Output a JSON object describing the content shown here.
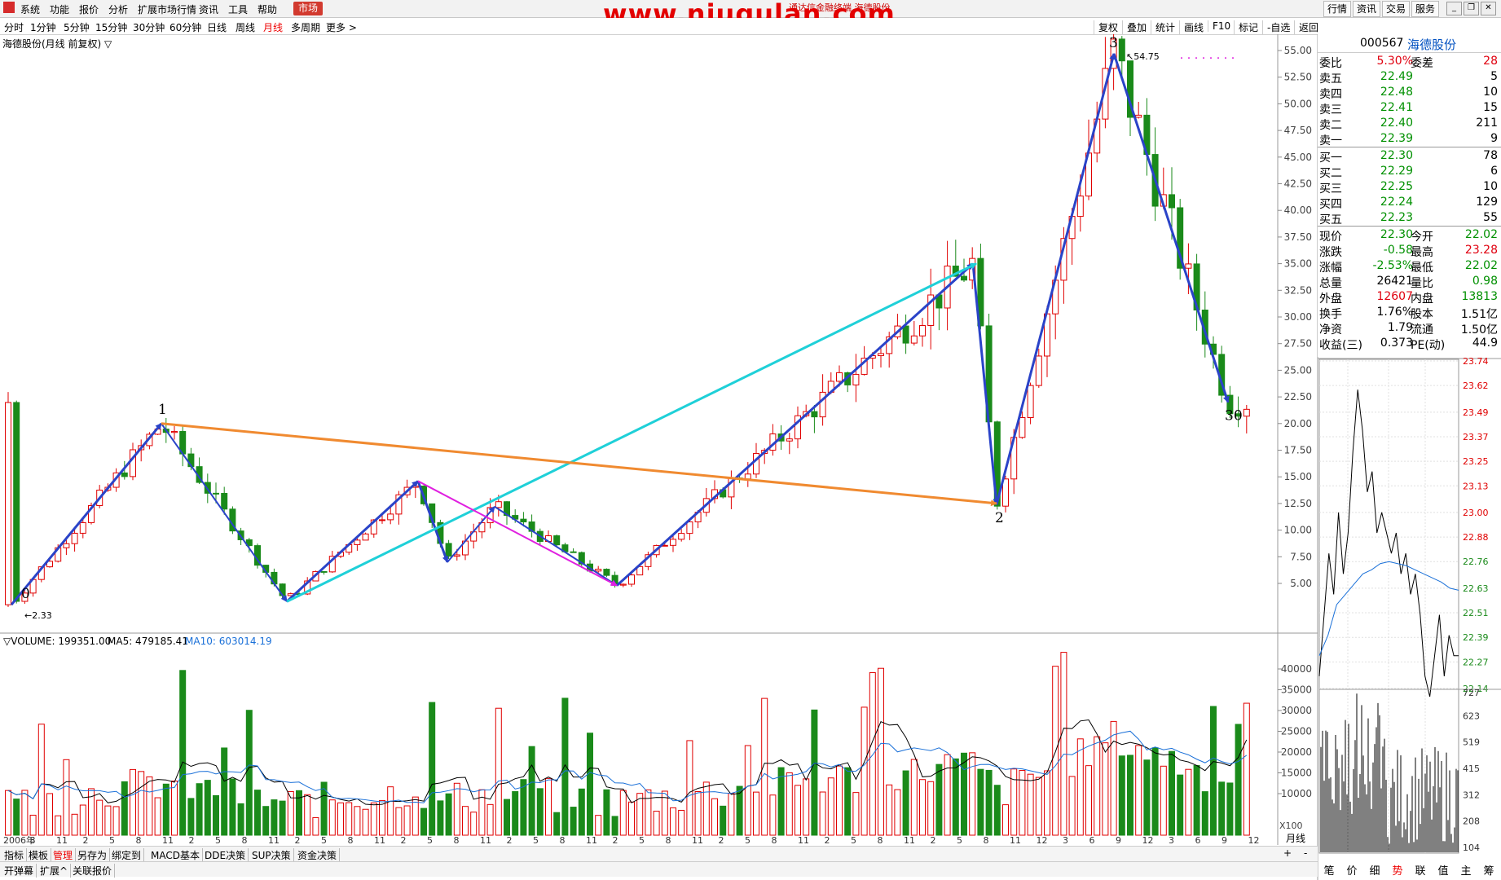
{
  "menu": {
    "items": [
      "系统",
      "功能",
      "报价",
      "分析",
      "扩展市场行情",
      "资讯",
      "工具",
      "帮助"
    ],
    "active": "市场",
    "watermark": "www.niugulan.com",
    "ticker": "通达信金融终端 海德股份",
    "right_buttons": [
      "行情",
      "资讯",
      "交易",
      "服务"
    ]
  },
  "periods": {
    "items": [
      "分时",
      "1分钟",
      "5分钟",
      "15分钟",
      "30分钟",
      "60分钟",
      "日线",
      "周线",
      "月线",
      "多周期",
      "更多 >"
    ],
    "selected": "月线",
    "tools": [
      "复权",
      "叠加",
      "统计",
      "画线",
      "F10",
      "标记",
      "-自选",
      "返回"
    ]
  },
  "chart": {
    "title": "海德股份(月线 前复权) ▽",
    "price_axis": [
      "55.00",
      "52.50",
      "50.00",
      "47.50",
      "45.00",
      "42.50",
      "40.00",
      "37.50",
      "35.00",
      "32.50",
      "30.00",
      "27.50",
      "25.00",
      "22.50",
      "20.00",
      "17.50",
      "15.00",
      "12.50",
      "10.00",
      "7.50",
      "5.00"
    ],
    "peak_label": "54.75",
    "low_label": "2.33",
    "wave_labels": [
      "0",
      "1",
      "2",
      "3",
      "30"
    ],
    "volume_title": "▽VOLUME: 199351.00",
    "ma5_label": "MA5: 479185.41",
    "ma10_label": "MA10: 603014.19",
    "volume_axis": [
      "40000",
      "35000",
      "30000",
      "25000",
      "20000",
      "15000",
      "10000"
    ],
    "volume_unit": "X100",
    "period_label": "月线",
    "x_labels": [
      "2006年",
      "8",
      "11",
      "2",
      "5",
      "8",
      "11",
      "2",
      "5",
      "8",
      "11",
      "2",
      "5",
      "8",
      "11",
      "2",
      "5",
      "8",
      "11",
      "2",
      "5",
      "8",
      "11",
      "2",
      "5",
      "8",
      "11",
      "2",
      "5",
      "8",
      "11",
      "2",
      "5",
      "8",
      "11",
      "2",
      "5",
      "8",
      "11",
      "12",
      "3",
      "6",
      "9",
      "12",
      "3",
      "6",
      "9",
      "12"
    ],
    "colors": {
      "up": "#e00000",
      "down": "#1a8a1a",
      "wave": "#2a43c8",
      "cyan": "#1fd0d8",
      "orange": "#f08a30",
      "magenta": "#e020e0",
      "ma5": "#000000",
      "ma10": "#1a70d8"
    }
  },
  "quote": {
    "code": "000567",
    "name": "海德股份",
    "weibi_label": "委比",
    "weibi": "5.30%",
    "weicha_label": "委差",
    "weicha": "28",
    "asks": [
      {
        "label": "卖五",
        "price": "22.49",
        "vol": "5"
      },
      {
        "label": "卖四",
        "price": "22.48",
        "vol": "10"
      },
      {
        "label": "卖三",
        "price": "22.41",
        "vol": "15"
      },
      {
        "label": "卖二",
        "price": "22.40",
        "vol": "211"
      },
      {
        "label": "卖一",
        "price": "22.39",
        "vol": "9"
      }
    ],
    "bids": [
      {
        "label": "买一",
        "price": "22.30",
        "vol": "78"
      },
      {
        "label": "买二",
        "price": "22.29",
        "vol": "6"
      },
      {
        "label": "买三",
        "price": "22.25",
        "vol": "10"
      },
      {
        "label": "买四",
        "price": "22.24",
        "vol": "129"
      },
      {
        "label": "买五",
        "price": "22.23",
        "vol": "55"
      }
    ],
    "stats": [
      {
        "l1": "现价",
        "v1": "22.30",
        "c1": "grn",
        "l2": "今开",
        "v2": "22.02",
        "c2": "grn"
      },
      {
        "l1": "涨跌",
        "v1": "-0.58",
        "c1": "grn",
        "l2": "最高",
        "v2": "23.28",
        "c2": "red"
      },
      {
        "l1": "涨幅",
        "v1": "-2.53%",
        "c1": "grn",
        "l2": "最低",
        "v2": "22.02",
        "c2": "grn"
      },
      {
        "l1": "总量",
        "v1": "26421",
        "c1": "",
        "l2": "量比",
        "v2": "0.98",
        "c2": "grn"
      },
      {
        "l1": "外盘",
        "v1": "12607",
        "c1": "red",
        "l2": "内盘",
        "v2": "13813",
        "c2": "grn"
      },
      {
        "l1": "换手",
        "v1": "1.76%",
        "c1": "",
        "l2": "股本",
        "v2": "1.51亿",
        "c2": ""
      },
      {
        "l1": "净资",
        "v1": "1.79",
        "c1": "",
        "l2": "流通",
        "v2": "1.50亿",
        "c2": ""
      },
      {
        "l1": "收益(三)",
        "v1": "0.373",
        "c1": "",
        "l2": "PE(动)",
        "v2": "44.9",
        "c2": ""
      }
    ]
  },
  "mini": {
    "title": "海德股份",
    "price": "22.30",
    "change": "-2.53%",
    "price_axis": [
      "23.74",
      "23.62",
      "23.49",
      "23.37",
      "23.25",
      "23.13",
      "23.00",
      "22.88",
      "22.76",
      "22.63",
      "22.51",
      "22.39",
      "22.27",
      "22.14"
    ],
    "vol_axis": [
      "727",
      "623",
      "519",
      "415",
      "312",
      "208",
      "104"
    ]
  },
  "bottom": {
    "tabs1": [
      "指标",
      "模板",
      "管理",
      "另存为",
      "绑定到",
      "MACD基本",
      "DDE决策",
      "SUP决策",
      "资金决策"
    ],
    "tabs1_selected": "管理",
    "tabs2": [
      "开弹幕",
      "扩展^",
      "关联报价"
    ],
    "right_tabs": [
      "笔",
      "价",
      "细",
      "势",
      "联",
      "值",
      "主",
      "筹"
    ],
    "right_selected": "势"
  }
}
